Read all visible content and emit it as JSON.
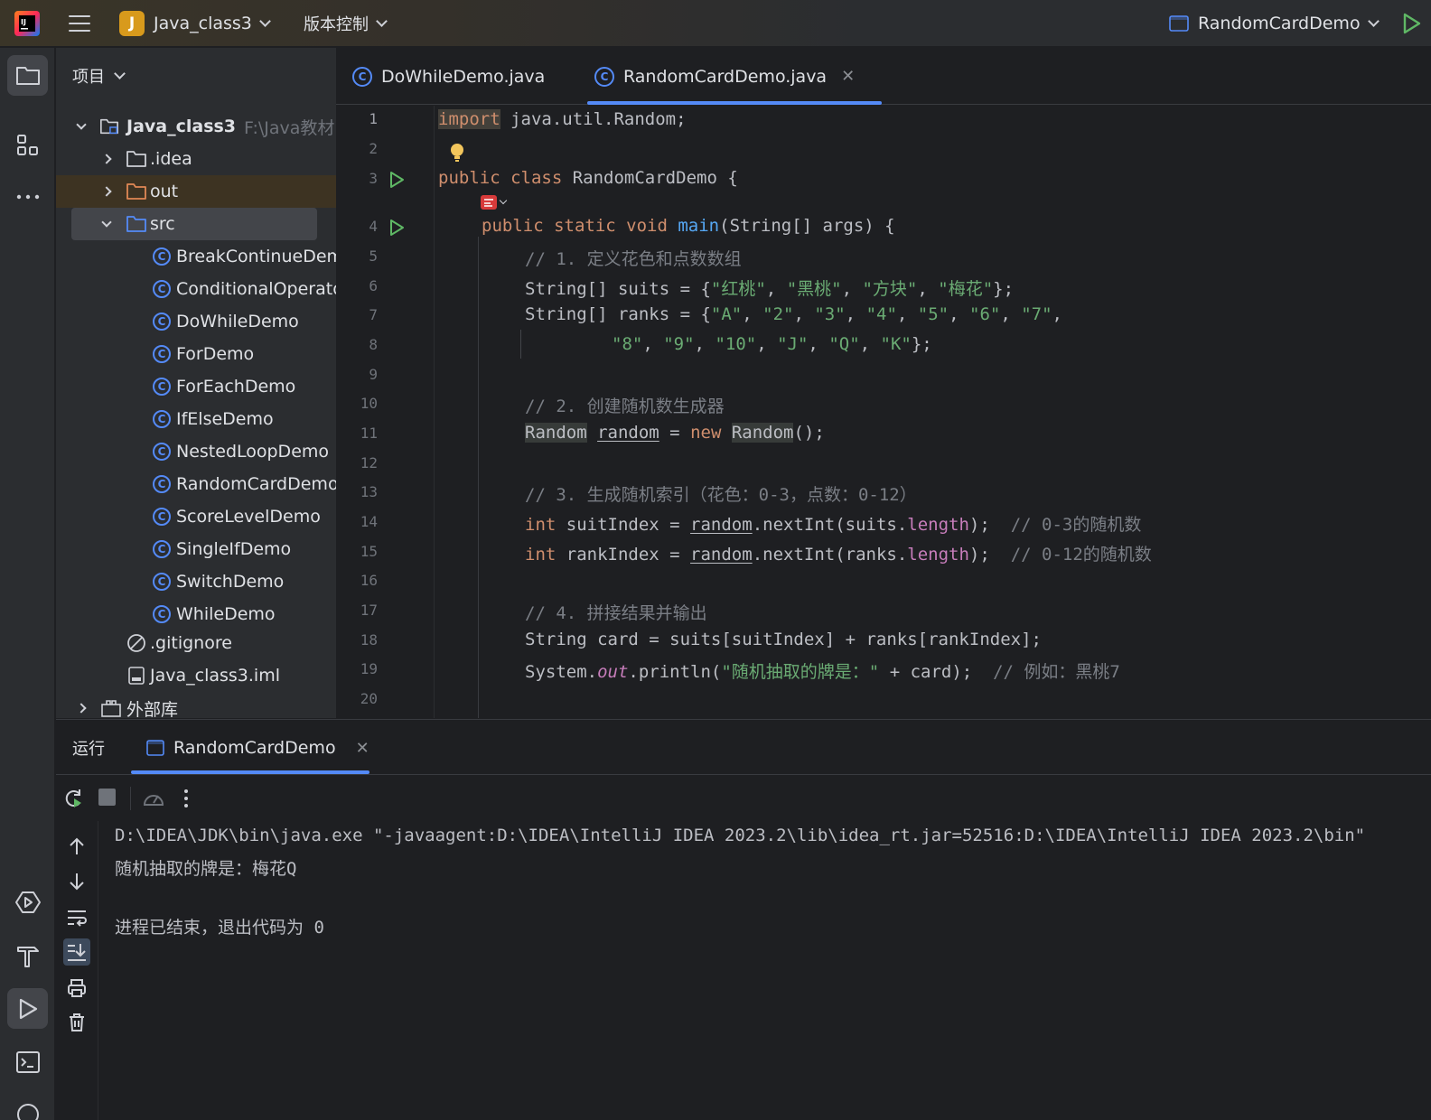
{
  "titlebar": {
    "project_badge": "J",
    "project_name": "Java_class3",
    "vcs_label": "版本控制",
    "run_config": "RandomCardDemo"
  },
  "project_panel": {
    "header": "项目",
    "root": {
      "name": "Java_class3",
      "path": "F:\\Java教材"
    },
    "items": [
      {
        "label": ".idea",
        "type": "folder"
      },
      {
        "label": "out",
        "type": "folder"
      },
      {
        "label": "src",
        "type": "folder"
      }
    ],
    "classes": [
      "BreakContinueDemo",
      "ConditionalOperato",
      "DoWhileDemo",
      "ForDemo",
      "ForEachDemo",
      "IfElseDemo",
      "NestedLoopDemo",
      "RandomCardDemo",
      "ScoreLevelDemo",
      "SingleIfDemo",
      "SwitchDemo",
      "WhileDemo"
    ],
    "files": [
      ".gitignore",
      "Java_class3.iml"
    ],
    "external": "外部库"
  },
  "editor": {
    "tabs": [
      {
        "label": "DoWhileDemo.java",
        "active": false
      },
      {
        "label": "RandomCardDemo.java",
        "active": true
      }
    ],
    "line_numbers": [
      "1",
      "2",
      "3",
      "4",
      "5",
      "6",
      "7",
      "8",
      "9",
      "10",
      "11",
      "12",
      "13",
      "14",
      "15",
      "16",
      "17",
      "18",
      "19",
      "20"
    ],
    "code": {
      "l1_import": "import",
      "l1_rest": " java.util.Random;",
      "l3_public": "public",
      "l3_class": "class",
      "l3_name": " RandomCardDemo {",
      "l4_mods": "public static void",
      "l4_main": "main",
      "l4_rest": "(String[] args) {",
      "l5": "// 1. 定义花色和点数数组",
      "l6_a": "String[] suits = {",
      "l6_s1": "\"红桃\"",
      "l6_s2": "\"黑桃\"",
      "l6_s3": "\"方块\"",
      "l6_s4": "\"梅花\"",
      "l6_end": "};",
      "l7_a": "String[] ranks = {",
      "l7_vals": [
        "\"A\"",
        "\"2\"",
        "\"3\"",
        "\"4\"",
        "\"5\"",
        "\"6\"",
        "\"7\""
      ],
      "l8_vals": [
        "\"8\"",
        "\"9\"",
        "\"10\"",
        "\"J\"",
        "\"Q\"",
        "\"K\""
      ],
      "l8_end": "};",
      "l10": "// 2. 创建随机数生成器",
      "l11_type": "Random",
      "l11_var": "random",
      "l11_eq": " = ",
      "l11_new": "new",
      "l11_ctor": "Random",
      "l11_end": "();",
      "l13": "// 3. 生成随机索引（花色：0-3，点数：0-12）",
      "l14_int": "int",
      "l14_a": " suitIndex = ",
      "l14_rand": "random",
      "l14_b": ".nextInt(suits.",
      "l14_len": "length",
      "l14_c": ");  ",
      "l14_cm": "// 0-3的随机数",
      "l15_int": "int",
      "l15_a": " rankIndex = ",
      "l15_rand": "random",
      "l15_b": ".nextInt(ranks.",
      "l15_len": "length",
      "l15_c": ");  ",
      "l15_cm": "// 0-12的随机数",
      "l17": "// 4. 拼接结果并输出",
      "l18": "String card = suits[suitIndex] + ranks[rankIndex];",
      "l19_a": "System.",
      "l19_out": "out",
      "l19_b": ".println(",
      "l19_str": "\"随机抽取的牌是：\"",
      "l19_c": " + card);  ",
      "l19_cm": "// 例如：黑桃7"
    }
  },
  "run_window": {
    "title": "运行",
    "tab": "RandomCardDemo",
    "console": [
      "D:\\IDEA\\JDK\\bin\\java.exe \"-javaagent:D:\\IDEA\\IntelliJ IDEA 2023.2\\lib\\idea_rt.jar=52516:D:\\IDEA\\IntelliJ IDEA 2023.2\\bin\"",
      "随机抽取的牌是：梅花Q",
      "",
      "进程已结束，退出代码为 0"
    ]
  },
  "colors": {
    "accent": "#548af7",
    "keyword": "#cf8e6d",
    "string": "#6aab73",
    "comment": "#7a7e85",
    "function": "#56a8f5",
    "field": "#c77dbb",
    "run_green": "#5fb865"
  }
}
